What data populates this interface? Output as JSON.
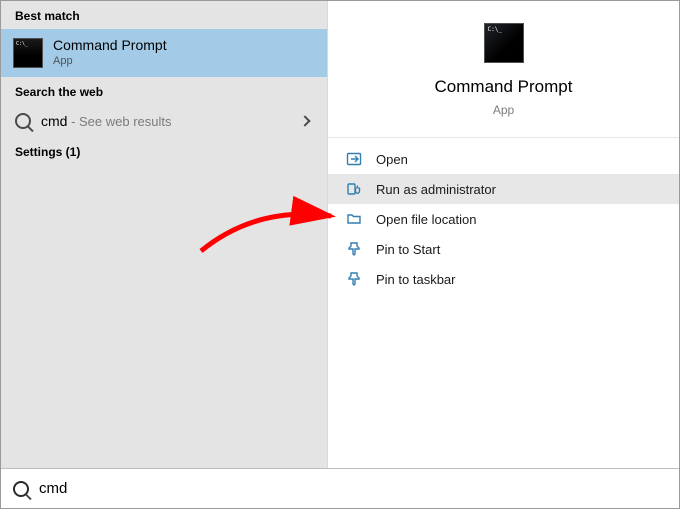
{
  "left": {
    "best_match_header": "Best match",
    "best_match": {
      "title": "Command Prompt",
      "subtitle": "App"
    },
    "web_header": "Search the web",
    "web": {
      "query": "cmd",
      "suffix": " - See web results"
    },
    "settings_header": "Settings (1)"
  },
  "right": {
    "title": "Command Prompt",
    "subtitle": "App",
    "actions": {
      "open": "Open",
      "run_admin": "Run as administrator",
      "open_loc": "Open file location",
      "pin_start": "Pin to Start",
      "pin_taskbar": "Pin to taskbar"
    }
  },
  "search_value": "cmd"
}
